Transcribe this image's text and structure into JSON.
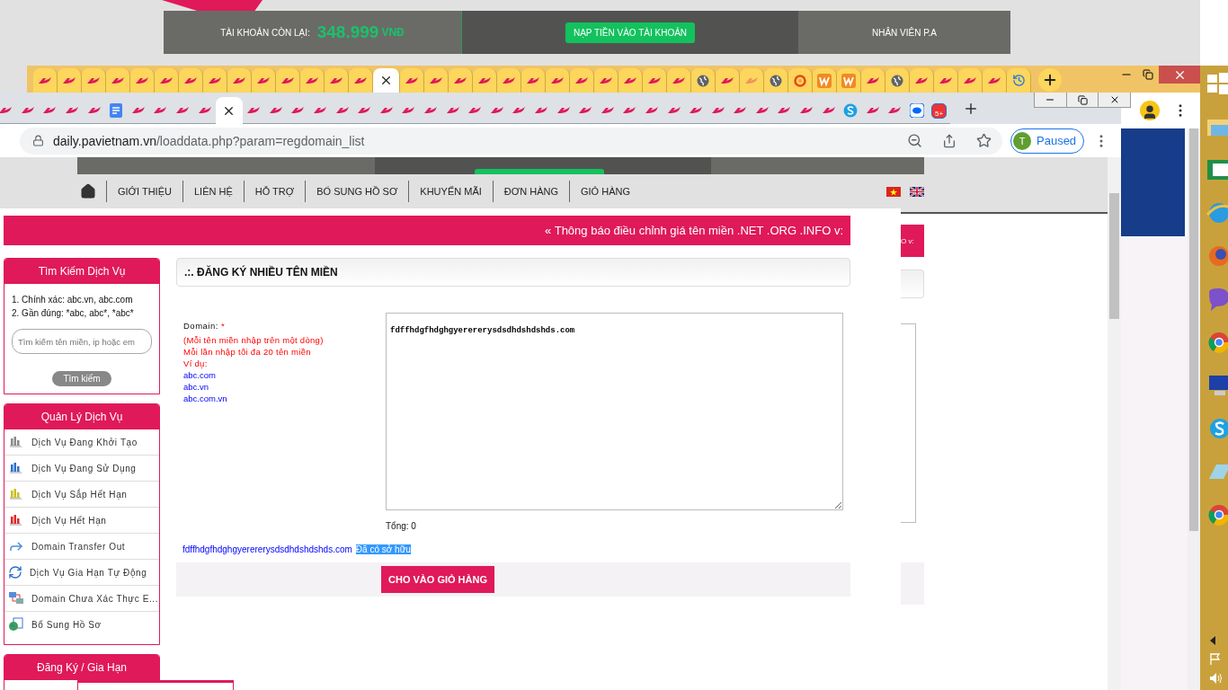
{
  "back_window": {
    "balance_label": "TÀI KHOẢN CÒN LẠI:",
    "balance": "348.999",
    "currency": "VNĐ",
    "deposit_button": "NẠP TIỀN VÀO TÀI KHOẢN",
    "staff": "NHÂN VIÊN P.A"
  },
  "outer_tabs": [
    {
      "kind": "pa",
      "selected": false
    },
    {
      "kind": "pa",
      "selected": false
    },
    {
      "kind": "pa",
      "selected": false
    },
    {
      "kind": "pa",
      "selected": false
    },
    {
      "kind": "pa",
      "selected": false
    },
    {
      "kind": "pa",
      "selected": false
    },
    {
      "kind": "pa",
      "selected": false
    },
    {
      "kind": "pa",
      "selected": false
    },
    {
      "kind": "pa",
      "selected": false
    },
    {
      "kind": "pa",
      "selected": false
    },
    {
      "kind": "pa",
      "selected": false
    },
    {
      "kind": "pa",
      "selected": false
    },
    {
      "kind": "pa",
      "selected": false
    },
    {
      "kind": "pa",
      "selected": false
    },
    {
      "selected": true
    },
    {
      "kind": "pa",
      "selected": false
    },
    {
      "kind": "pa",
      "selected": false
    },
    {
      "kind": "pa",
      "selected": false
    },
    {
      "kind": "pa",
      "selected": false
    },
    {
      "kind": "pa",
      "selected": false
    },
    {
      "kind": "pa",
      "selected": false
    },
    {
      "kind": "pa",
      "selected": false
    },
    {
      "kind": "pa",
      "selected": false
    },
    {
      "kind": "pa",
      "selected": false
    },
    {
      "kind": "pa",
      "selected": false
    },
    {
      "kind": "pa",
      "selected": false
    },
    {
      "kind": "pa",
      "selected": false
    },
    {
      "kind": "globe",
      "selected": false
    },
    {
      "kind": "pa",
      "selected": false
    },
    {
      "kind": "pa-faded",
      "selected": false
    },
    {
      "kind": "globe",
      "selected": false
    },
    {
      "kind": "swirl",
      "selected": false
    },
    {
      "kind": "w",
      "selected": false
    },
    {
      "kind": "w",
      "selected": false
    },
    {
      "kind": "pa",
      "selected": false
    },
    {
      "kind": "globe",
      "selected": false
    },
    {
      "kind": "pa",
      "selected": false
    },
    {
      "kind": "pa",
      "selected": false
    },
    {
      "kind": "pa",
      "selected": false
    },
    {
      "kind": "pa",
      "selected": false
    },
    {
      "kind": "history",
      "selected": false
    }
  ],
  "browser": {
    "tabs": [
      {
        "kind": "pa",
        "selected": false
      },
      {
        "kind": "pa",
        "selected": false
      },
      {
        "kind": "pa",
        "selected": false
      },
      {
        "kind": "pa",
        "selected": false
      },
      {
        "kind": "pa",
        "selected": false
      },
      {
        "kind": "doc",
        "selected": false
      },
      {
        "kind": "pa",
        "selected": false
      },
      {
        "kind": "pa",
        "selected": false
      },
      {
        "kind": "pa",
        "selected": false
      },
      {
        "kind": "pa",
        "selected": false
      },
      {
        "selected": true
      },
      {
        "kind": "pa",
        "selected": false
      },
      {
        "kind": "pa",
        "selected": false
      },
      {
        "kind": "pa",
        "selected": false
      },
      {
        "kind": "pa",
        "selected": false
      },
      {
        "kind": "pa",
        "selected": false
      },
      {
        "kind": "pa",
        "selected": false
      },
      {
        "kind": "pa",
        "selected": false
      },
      {
        "kind": "pa",
        "selected": false
      },
      {
        "kind": "pa",
        "selected": false
      },
      {
        "kind": "pa",
        "selected": false
      },
      {
        "kind": "pa",
        "selected": false
      },
      {
        "kind": "pa",
        "selected": false
      },
      {
        "kind": "pa",
        "selected": false
      },
      {
        "kind": "pa",
        "selected": false
      },
      {
        "kind": "pa",
        "selected": false
      },
      {
        "kind": "pa",
        "selected": false
      },
      {
        "kind": "pa",
        "selected": false
      },
      {
        "kind": "pa",
        "selected": false
      },
      {
        "kind": "pa",
        "selected": false
      },
      {
        "kind": "pa",
        "selected": false
      },
      {
        "kind": "pa",
        "selected": false
      },
      {
        "kind": "pa",
        "selected": false
      },
      {
        "kind": "pa",
        "selected": false
      },
      {
        "kind": "pa",
        "selected": false
      },
      {
        "kind": "pa",
        "selected": false
      },
      {
        "kind": "pa",
        "selected": false
      },
      {
        "kind": "pa",
        "selected": false
      },
      {
        "kind": "skype",
        "selected": false
      },
      {
        "kind": "pa",
        "selected": false
      },
      {
        "kind": "pa",
        "selected": false
      },
      {
        "kind": "zalo",
        "selected": false
      },
      {
        "kind": "badge",
        "badge": "5+",
        "selected": false
      }
    ],
    "url_domain": "daily.pavietnam.vn",
    "url_path": "/loaddata.php?param=regdomain_list",
    "profile_initial": "T",
    "profile_status": "Paused"
  },
  "nav": {
    "items": [
      "GIỚI THIỆU",
      "LIÊN HỆ",
      "HỖ TRỢ",
      "BỔ SUNG HỒ SƠ",
      "KHUYẾN MÃI",
      "ĐƠN HÀNG",
      "GIỎ HÀNG"
    ]
  },
  "notice": "« Thông báo điều chỉnh giá tên miền .NET .ORG .INFO v:",
  "ghost_notice": "O v:",
  "sidebar": {
    "search": {
      "title": "Tìm Kiếm Dịch Vụ",
      "hints": [
        "1. Chính xác: abc.vn, abc.com",
        "2. Gần đúng: *abc, abc*, *abc*"
      ],
      "placeholder": "Tìm kiếm tên miền, ip hoặc em",
      "button": "Tìm kiếm"
    },
    "services": {
      "title": "Quản Lý Dịch Vụ",
      "items": [
        {
          "label": "Dịch Vụ Đang Khởi Tạo",
          "kind": "bars",
          "color": "#8a8a8a"
        },
        {
          "label": "Dịch Vụ Đang Sử Dụng",
          "kind": "bars",
          "color": "#2d6fd0"
        },
        {
          "label": "Dịch Vụ Sắp Hết Hạn",
          "kind": "bars",
          "color": "#c8c020"
        },
        {
          "label": "Dịch Vụ Hết Hạn",
          "kind": "bars",
          "color": "#e02828"
        },
        {
          "label": "Domain Transfer Out",
          "kind": "transfer"
        },
        {
          "label": "Dịch Vụ Gia Hạn Tự Động",
          "kind": "renew"
        },
        {
          "label": "Domain Chưa Xác Thực E...",
          "kind": "verify"
        },
        {
          "label": "Bổ Sung Hồ Sơ",
          "kind": "profile"
        }
      ]
    },
    "register": {
      "title": "Đăng Ký / Gia Hạn"
    }
  },
  "form": {
    "title": ".:. ĐĂNG KÝ NHIỀU TÊN MIỀN",
    "label": "Domain:",
    "required": "*",
    "notes": [
      "(Mỗi tên miền nhập trên một dòng)",
      "Mỗi lần nhập tối đa 20 tên miền",
      "Ví dụ:"
    ],
    "examples": [
      "abc.com",
      "abc.vn",
      "abc.com.vn"
    ],
    "value": "fdffhdgfhdghgyerererysdsdhdshdshds.com",
    "total": "Tổng: 0",
    "result": {
      "domain": "fdffhdgfhdghgyerererysdsdhdshdshds.com",
      "status": "Đã có sở hữu",
      "highlighted": true
    },
    "submit": "CHO VÀO GIỎ HÀNG"
  }
}
